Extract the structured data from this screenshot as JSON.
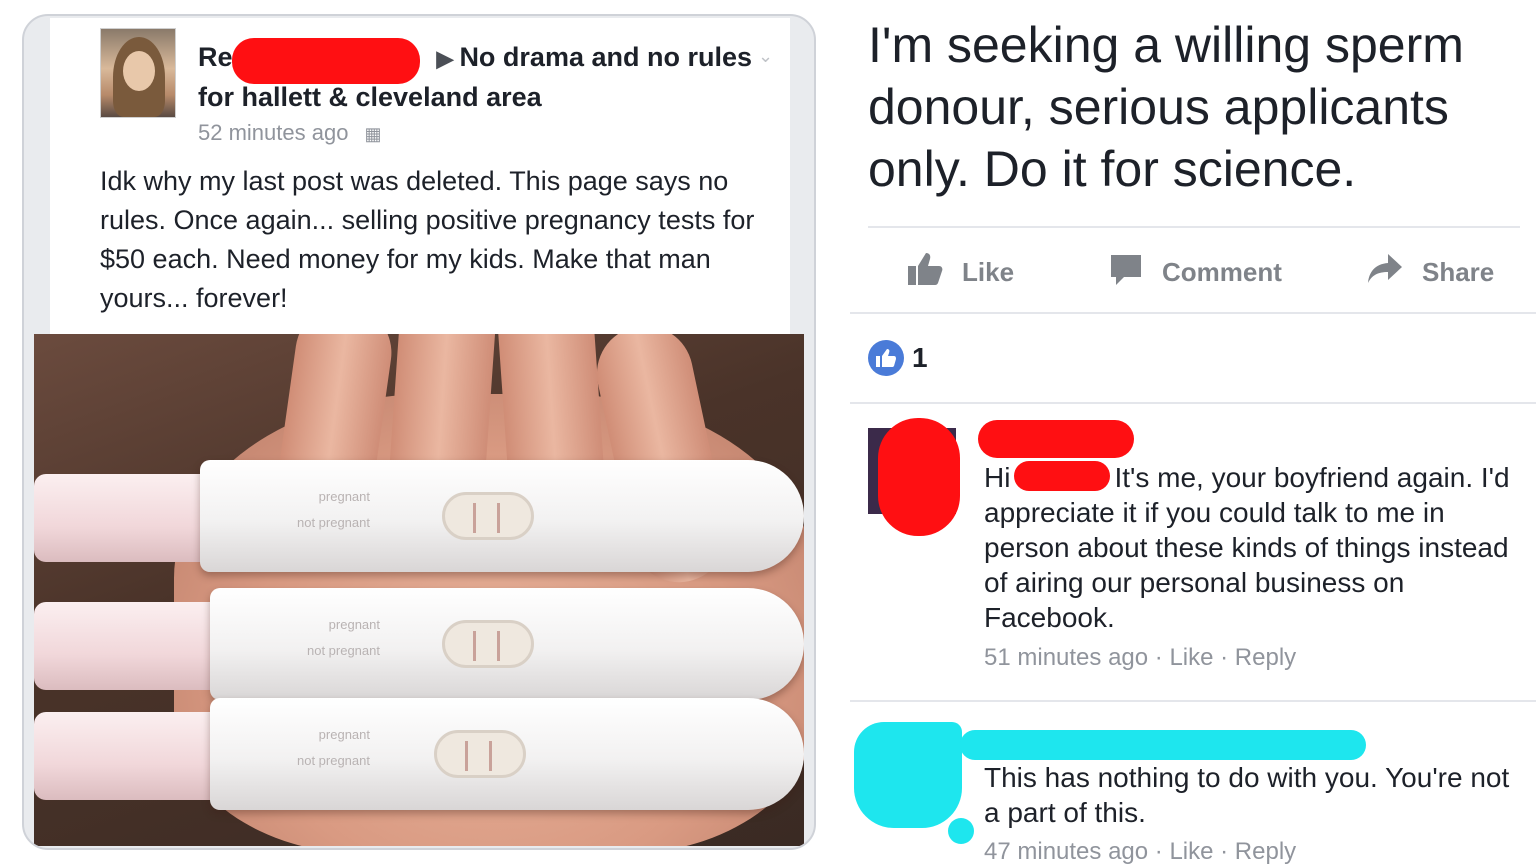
{
  "left_post": {
    "group_prefix": "Re",
    "group_name": "No drama and no rules for hallett & cleveland area",
    "time": "52 minutes ago",
    "body": "Idk why my last post was deleted. This page says no rules. Once again... selling positive pregnancy tests for $50 each. Need money for my kids. Make that man yours... forever!",
    "photo": {
      "tests": [
        {
          "label_top": "pregnant",
          "label_bottom": "not pregnant"
        },
        {
          "label_top": "pregnant",
          "label_bottom": "not pregnant"
        },
        {
          "label_top": "pregnant",
          "label_bottom": "not pregnant"
        }
      ]
    }
  },
  "right_post": {
    "status": "I'm seeking a willing sperm donour, serious applicants only. Do it for science.",
    "actions": {
      "like": "Like",
      "comment": "Comment",
      "share": "Share"
    },
    "like_count": "1",
    "comments": [
      {
        "greeting": "Hi",
        "text": "It's me, your boyfriend again. I'd appreciate it if you could talk to me in person about these kinds of things instead of airing our personal business on Facebook.",
        "time": "51 minutes ago",
        "like": "Like",
        "reply": "Reply"
      },
      {
        "text": "This has nothing to do with you. You're not a part of this.",
        "time": "47 minutes ago",
        "like": "Like",
        "reply": "Reply"
      }
    ]
  },
  "colors": {
    "redaction_red": "#ff0f12",
    "redaction_cyan": "#1ee6ee",
    "facebook_blue": "#4a7bd8",
    "meta_gray": "#90949c"
  }
}
